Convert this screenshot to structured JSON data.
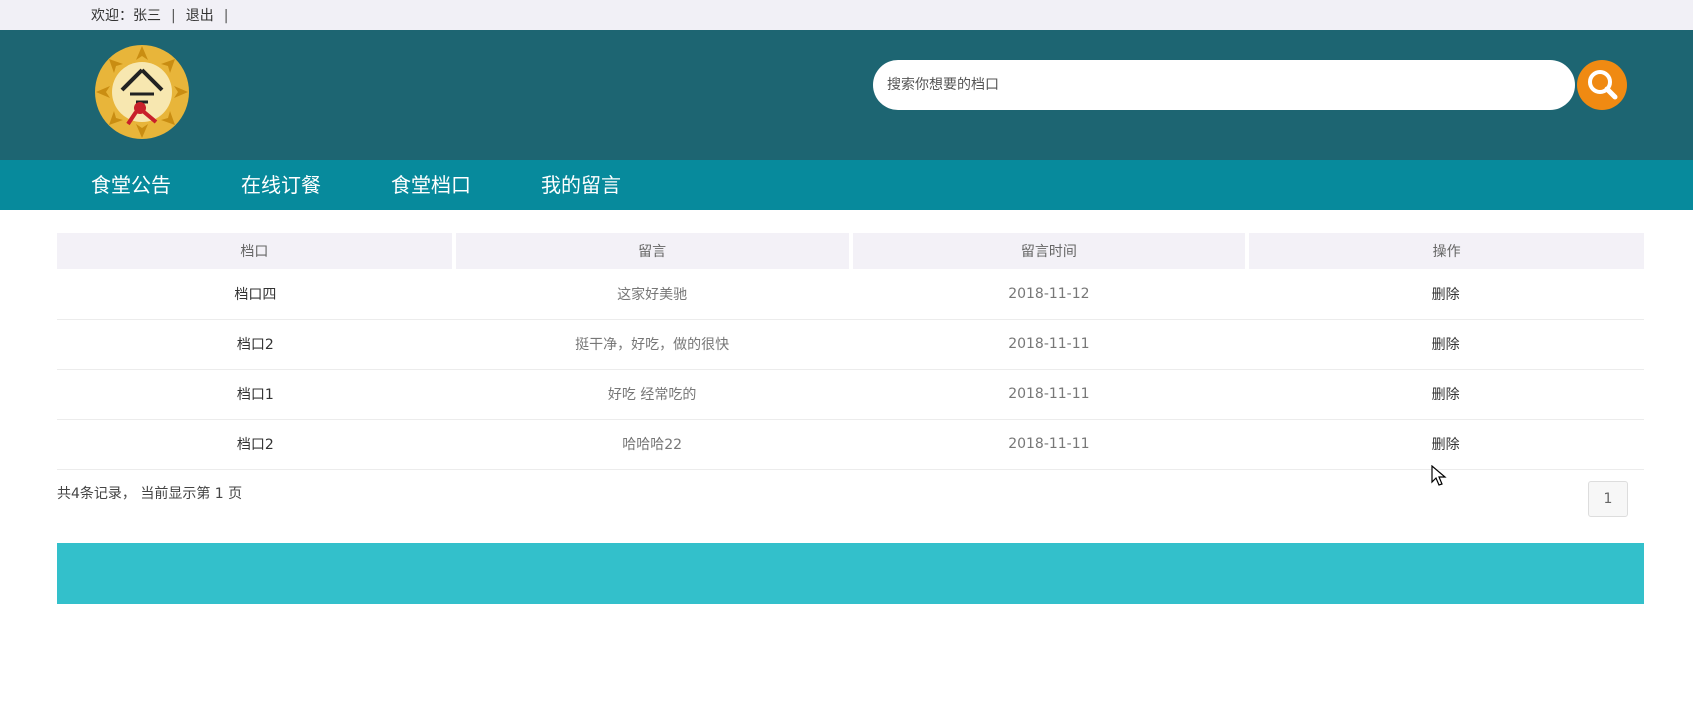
{
  "topbar": {
    "welcome_label": "欢迎：",
    "username": "张三",
    "separator": "|",
    "logout": "退出"
  },
  "header": {
    "logo_icon": "canteen-logo-icon",
    "search": {
      "placeholder": "搜索你想要的档口",
      "value": ""
    },
    "search_icon": "search-icon",
    "colors": {
      "header_bg": "#1d6572",
      "nav_bg": "#078a9c",
      "search_button": "#f08a12",
      "footer_bg": "#33c0cb"
    }
  },
  "nav": {
    "items": [
      {
        "label": "食堂公告"
      },
      {
        "label": "在线订餐"
      },
      {
        "label": "食堂档口"
      },
      {
        "label": "我的留言"
      }
    ]
  },
  "table": {
    "headers": [
      "档口",
      "留言",
      "留言时间",
      "操作"
    ],
    "rows": [
      {
        "stall": "档口四",
        "message": "这家好美驰",
        "time": "2018-11-12",
        "action": "删除"
      },
      {
        "stall": "档口2",
        "message": "挺干净，好吃，做的很快",
        "time": "2018-11-11",
        "action": "删除"
      },
      {
        "stall": "档口1",
        "message": "好吃 经常吃的",
        "time": "2018-11-11",
        "action": "删除"
      },
      {
        "stall": "档口2",
        "message": "哈哈哈22",
        "time": "2018-11-11",
        "action": "删除"
      }
    ]
  },
  "pagination": {
    "summary": "共4条记录， 当前显示第 1 页",
    "pages": [
      "1"
    ]
  }
}
